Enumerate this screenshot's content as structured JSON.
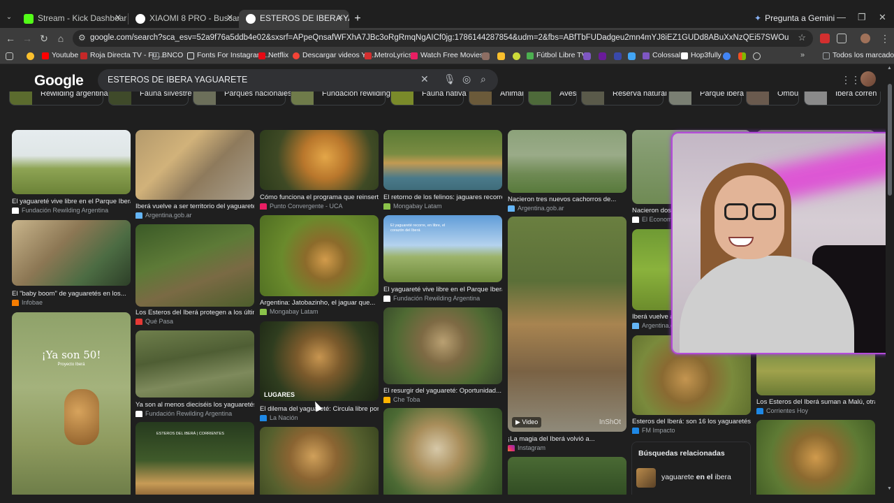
{
  "browser": {
    "tabs": [
      {
        "title": "Stream - Kick Dashboard",
        "color": "#53fc18"
      },
      {
        "title": "XIAOMI 8 PRO - Buscar con Go",
        "color": "#e8eaed"
      },
      {
        "title": "ESTEROS DE IBERA YAGUARETE",
        "color": "#e8eaed",
        "active": true
      }
    ],
    "gemini_label": "Pregunta a Gemini",
    "url": "google.com/search?sca_esv=52a9f76a5ddb4e02&sxsrf=APpeQnsafWFXhA7JBc3oRgRmqNgAICf0jg:1786144287854&udm=2&fbs=ABfTbFUDadgeu2mn4mYJ8iEZ1GUDd8ABuXxNzQEi57SWOuuPdWnr6CbjjqIObRHAsFy-UJWoTM8aZiBG_34I3eK...",
    "bookmarks": [
      {
        "label": "Youtube",
        "color": "#ff0000"
      },
      {
        "label": "Roja Directa TV - Fu...",
        "color": "#c62828"
      },
      {
        "label": "BNCO",
        "color": "#9aa0a6"
      },
      {
        "label": "Fonts For Instagram...",
        "color": "#e8eaed"
      },
      {
        "label": "Netflix",
        "color": "#e50914"
      },
      {
        "label": "Descargar videos Yo...",
        "color": "#f44336"
      },
      {
        "label": "MetroLyrics",
        "color": "#d32f2f"
      },
      {
        "label": "Watch Free Movies...",
        "color": "#e91e63"
      },
      {
        "label": "Fútbol Libre TV",
        "color": "#4caf50"
      },
      {
        "label": "Colossal",
        "color": "#7e57c2"
      },
      {
        "label": "Hop3fully",
        "color": "#ffffff"
      },
      {
        "label": "Todos los marcadores",
        "color": "#9aa0a6"
      }
    ]
  },
  "google": {
    "logo": "Google",
    "query": "ESTEROS DE IBERA YAGUARETE",
    "chips": [
      {
        "label": "Rewilding argentina",
        "color": "#5b6b2e"
      },
      {
        "label": "Fauna silvestre",
        "color": "#3f4a2a"
      },
      {
        "label": "Parques nacionales",
        "color": "#6c6f5a"
      },
      {
        "label": "Fundación rewilding",
        "color": "#6f7b4a"
      },
      {
        "label": "Fauna nativa",
        "color": "#7a8a2a"
      },
      {
        "label": "Animal",
        "color": "#6b5a3a"
      },
      {
        "label": "Aves",
        "color": "#4e6a3a"
      },
      {
        "label": "Reserva natural",
        "color": "#5a5a4a"
      },
      {
        "label": "Parque iberá",
        "color": "#7a7f73"
      },
      {
        "label": "Ombú",
        "color": "#6a5a4e"
      },
      {
        "label": "Iberá corren",
        "color": "#8a8a8a"
      }
    ],
    "results": [
      {
        "caption": "El yaguareté vive libre en el Parque Iberá - ...",
        "source": "Fundación Rewilding Argentina"
      },
      {
        "caption": "Iberá vuelve a ser territorio del yaguareté ...",
        "source": "Argentina.gob.ar"
      },
      {
        "caption": "Cómo funciona el programa que reinserta...",
        "source": "Punto Convergente - UCA"
      },
      {
        "caption": "El retorno de los felinos: jaguares recorren...",
        "source": "Mongabay Latam"
      },
      {
        "caption": "Nacieron tres nuevos cachorros de...",
        "source": "Argentina.gob.ar"
      },
      {
        "caption": "Nacieron dos y",
        "source": "El Economi"
      },
      {
        "caption": "El \"baby boom\" de yaguaretés en los...",
        "source": "Infobae"
      },
      {
        "caption": "Los Esteros del Iberá protegen a los últim...",
        "source": "Qué Pasa"
      },
      {
        "caption": "Argentina: Jatobazinho, el jaguar que...",
        "source": "Mongabay Latam"
      },
      {
        "caption": "El yaguareté vive libre en el Parque Iberá - ...",
        "source": "Fundación Rewilding Argentina"
      },
      {
        "caption": "Iberá vuelve a",
        "source": "Argentina.g"
      },
      {
        "caption": "Ya son al menos dieciséis los yaguaretés...",
        "source": "Fundación Rewilding Argentina"
      },
      {
        "caption": "El dilema del yaguareté: Circula libre por...",
        "source": "La Nación"
      },
      {
        "caption": "El resurgir del yaguareté: Oportunidad...",
        "source": "Che Toba"
      },
      {
        "caption": "¡La magia del Iberá volvió a...",
        "source": "Instagram"
      },
      {
        "caption": "Esteros del Iberá: son 16 los yaguaretés q...",
        "source": "FM Impacto"
      },
      {
        "caption": "Los Esteros del Iberá suman a Malú, otra...",
        "source": "Corrientes Hoy"
      }
    ],
    "overlay_ya_son_50": "¡Ya son 50!",
    "overlay_proyecto": "Proyecto Iberá",
    "overlay_esteros": "ESTEROS DEL IBERÁ | CORRIENTES",
    "overlay_yaguarete_recorre": "El yaguareté recorre, en libre, el corazón del Iberá",
    "badge_lugares": "LUGARES",
    "badge_video": "Video",
    "watermark_inshot": "InShOt",
    "related_title": "Búsquedas relacionadas",
    "related_query_plain": "yaguarete ",
    "related_query_bold": "en el",
    "related_query_tail": " ibera"
  }
}
